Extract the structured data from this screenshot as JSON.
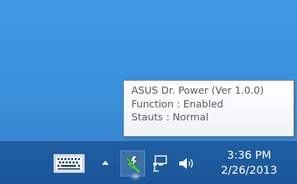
{
  "tooltip": {
    "line1": "ASUS Dr. Power (Ver 1.0.0)",
    "line2": "Function : Enabled",
    "line3": "Stauts : Normal"
  },
  "taskbar": {
    "keyboard_icon": "touch-keyboard-icon",
    "show_hidden_icon": "chevron-up-icon",
    "power_icon": "asus-dr-power-icon",
    "network_icon": "network-icon",
    "volume_icon": "speaker-icon",
    "time": "3:36 PM",
    "date": "2/26/2013"
  },
  "colors": {
    "desktop": "#3a8fd9",
    "taskbar": "#1d5a9e",
    "power_green": "#4fc24a",
    "tooltip_text": "#5a5a5a"
  }
}
